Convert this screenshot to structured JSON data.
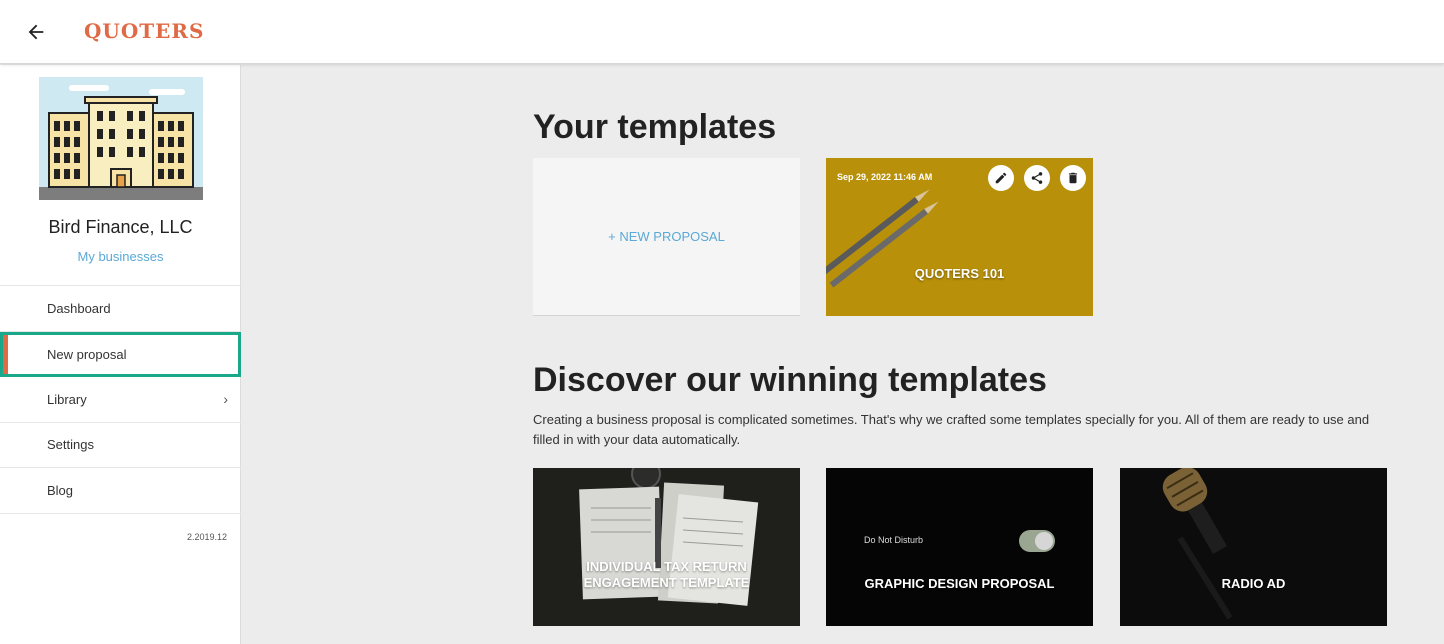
{
  "header": {
    "back_icon": "arrow-left-icon",
    "logo": "QUOTERS"
  },
  "sidebar": {
    "business_name": "Bird Finance, LLC",
    "business_link": "My businesses",
    "items": [
      {
        "label": "Dashboard",
        "active": false
      },
      {
        "label": "New proposal",
        "active": true
      },
      {
        "label": "Library",
        "has_chevron": true
      },
      {
        "label": "Settings"
      },
      {
        "label": "Blog"
      }
    ],
    "version": "2.2019.12"
  },
  "main": {
    "your_templates_heading": "Your templates",
    "new_proposal_label": "+ NEW PROPOSAL",
    "user_templates": [
      {
        "title": "QUOTERS 101",
        "date": "Sep 29, 2022 11:46 AM",
        "actions": [
          "pencil-icon",
          "share-icon",
          "trash-icon"
        ]
      }
    ],
    "discover_heading": "Discover our winning templates",
    "discover_text": "Creating a business proposal is complicated sometimes. That's why we crafted some templates specially for you. All of them are ready to use and filled in with your data automatically.",
    "winning_templates": [
      {
        "title_line1": "INDIVIDUAL TAX RETURN",
        "title_line2": "ENGAGEMENT TEMPLATE"
      },
      {
        "title": "GRAPHIC DESIGN PROPOSAL",
        "overlay_text": "Do Not Disturb"
      },
      {
        "title": "RADIO AD"
      }
    ]
  },
  "colors": {
    "brand": "#e06a45",
    "link": "#5aa9d6",
    "active_outline": "#1aa88a",
    "quoters_card": "#b8900a"
  }
}
